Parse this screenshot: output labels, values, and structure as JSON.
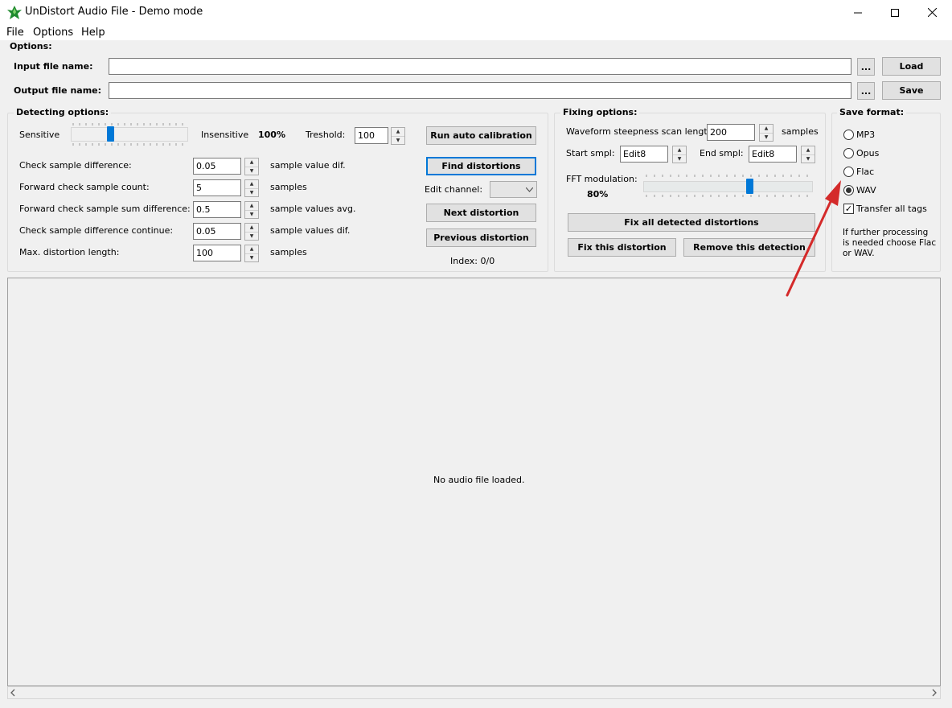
{
  "window": {
    "title": "UnDistort Audio File - Demo mode"
  },
  "menu": [
    "File",
    "Options",
    "Help"
  ],
  "options_label": "Options:",
  "input_file": {
    "label": "Input file name:",
    "value": "",
    "browse": "...",
    "button": "Load"
  },
  "output_file": {
    "label": "Output file name:",
    "value": "",
    "browse": "...",
    "button": "Save"
  },
  "detecting": {
    "title": "Detecting options:",
    "sensitive": "Sensitive",
    "insensitive": "Insensitive",
    "percent": "100%",
    "slider_level": 0.33,
    "treshold_label": "Treshold:",
    "treshold_value": "100",
    "rows": [
      {
        "label": "Check sample difference:",
        "value": "0.05",
        "unit": "sample value dif."
      },
      {
        "label": "Forward check sample count:",
        "value": "5",
        "unit": "samples"
      },
      {
        "label": "Forward check sample sum difference:",
        "value": "0.5",
        "unit": "sample values avg."
      },
      {
        "label": "Check sample difference continue:",
        "value": "0.05",
        "unit": "sample values dif."
      },
      {
        "label": "Max. distortion length:",
        "value": "100",
        "unit": "samples"
      }
    ],
    "run_calibration": "Run auto calibration",
    "find_distortions": "Find distortions",
    "edit_channel": "Edit channel:",
    "next_distortion": "Next distortion",
    "previous_distortion": "Previous distortion",
    "index": "Index: 0/0"
  },
  "fixing": {
    "title": "Fixing options:",
    "scan_label": "Waveform steepness scan length:",
    "scan_value": "200",
    "scan_unit": "samples",
    "start_label": "Start smpl:",
    "start_value": "Edit8",
    "end_label": "End smpl:",
    "end_value": "Edit8",
    "fft_label": "FFT modulation:",
    "fft_percent": "80%",
    "fft_level": 0.8,
    "fix_all": "Fix all detected distortions",
    "fix_this": "Fix this distortion",
    "remove_detection": "Remove this detection"
  },
  "save_format": {
    "title": "Save format:",
    "options": [
      "MP3",
      "Opus",
      "Flac",
      "WAV"
    ],
    "selected": "WAV",
    "transfer_tags": "Transfer all tags",
    "transfer_checked": true,
    "note_lines": [
      "If further processing",
      "is needed choose Flac",
      "or WAV."
    ]
  },
  "waveform": {
    "empty_text": "No audio file loaded."
  },
  "colors": {
    "accent": "#0078d7",
    "annotation_arrow": "#d42a2a"
  }
}
